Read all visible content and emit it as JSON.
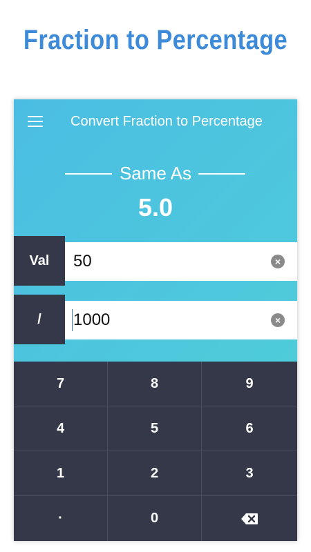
{
  "hero": {
    "title": "Fraction to Percentage"
  },
  "appbar": {
    "title": "Convert Fraction to Percentage",
    "menu_icon": "hamburger-menu-icon"
  },
  "result": {
    "label": "Same As",
    "value": "5.0"
  },
  "inputs": {
    "numerator": {
      "tag": "Val",
      "value": "50",
      "clear_icon": "clear-icon"
    },
    "denominator": {
      "tag": "/",
      "value": "1000",
      "clear_icon": "clear-icon"
    }
  },
  "keypad": {
    "keys": [
      "7",
      "8",
      "9",
      "4",
      "5",
      "6",
      "1",
      "2",
      "3",
      "·",
      "0"
    ],
    "backspace_icon": "backspace-icon"
  },
  "colors": {
    "accent": "#3d8ad8",
    "gradient_start": "#4bbde3",
    "gradient_end": "#4fd1d6",
    "dark": "#343848"
  }
}
